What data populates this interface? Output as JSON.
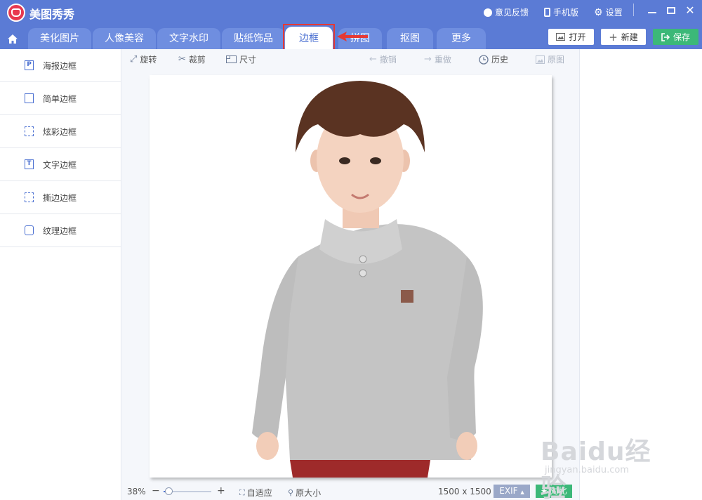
{
  "app": {
    "title": "美图秀秀"
  },
  "titlebar": {
    "feedback": "意见反馈",
    "mobile": "手机版",
    "settings": "设置"
  },
  "tabs": [
    {
      "label": "美化图片"
    },
    {
      "label": "人像美容"
    },
    {
      "label": "文字水印"
    },
    {
      "label": "贴纸饰品"
    },
    {
      "label": "边框",
      "active": true
    },
    {
      "label": "拼图"
    },
    {
      "label": "抠图"
    },
    {
      "label": "更多"
    }
  ],
  "actions": {
    "open": "打开",
    "new": "新建",
    "save": "保存"
  },
  "sidebar": {
    "items": [
      {
        "label": "海报边框",
        "icon": "P"
      },
      {
        "label": "简单边框",
        "icon": ""
      },
      {
        "label": "炫彩边框",
        "icon": ""
      },
      {
        "label": "文字边框",
        "icon": "T"
      },
      {
        "label": "撕边边框",
        "icon": ""
      },
      {
        "label": "纹理边框",
        "icon": ""
      }
    ]
  },
  "toolbar": {
    "rotate": "旋转",
    "crop": "裁剪",
    "size": "尺寸",
    "undo": "撤销",
    "redo": "重做",
    "history": "历史",
    "original": "原图"
  },
  "status": {
    "zoom": "38%",
    "zoom_fraction": 0.1,
    "fit": "自适应",
    "actual_size": "原大小",
    "dimensions": "1500 x 1500",
    "exif": "EXIF",
    "compare": "对比"
  },
  "watermark": {
    "text": "Baidu经验",
    "sub": "jingyan.baidu.com"
  },
  "colors": {
    "header": "#5b7bd5",
    "accent": "#4a6fd1",
    "save": "#3cb878",
    "highlight": "#e53935"
  }
}
